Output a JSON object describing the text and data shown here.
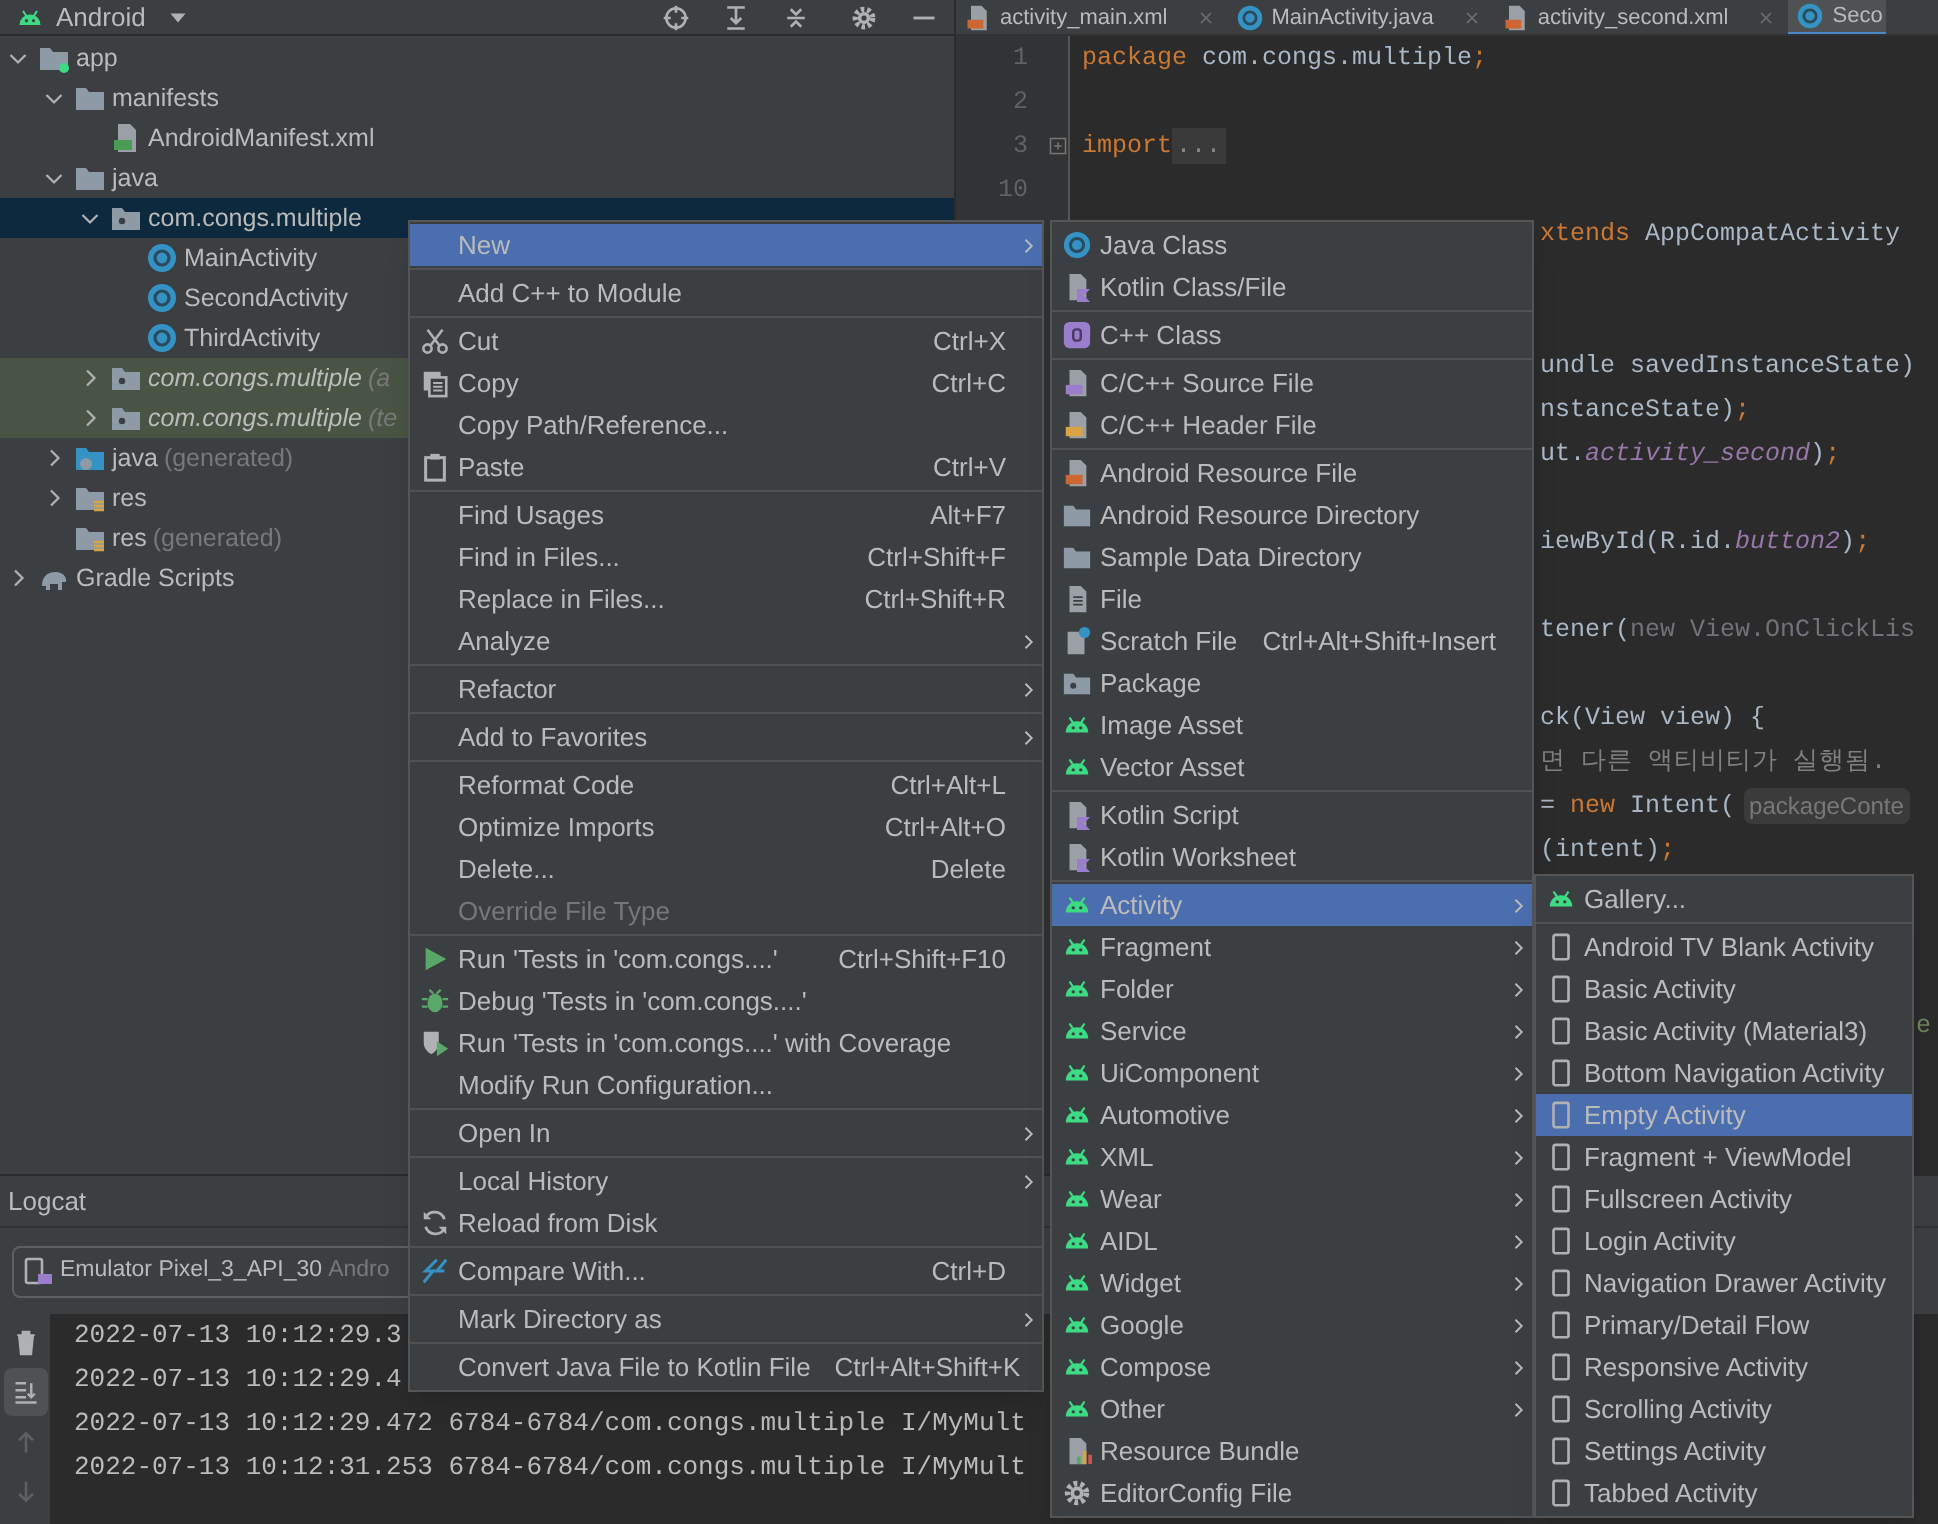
{
  "project_panel": {
    "title": "Android",
    "tree": [
      {
        "label": "app",
        "kind": "module",
        "expanded": true,
        "selected": false,
        "tinted": false,
        "children": [
          {
            "label": "manifests",
            "kind": "folder",
            "expanded": true,
            "selected": false,
            "tinted": false,
            "children": [
              {
                "label": "AndroidManifest.xml",
                "kind": "manifest",
                "selected": false,
                "tinted": false
              }
            ]
          },
          {
            "label": "java",
            "kind": "folder",
            "expanded": true,
            "selected": false,
            "tinted": false,
            "children": [
              {
                "label": "com.congs.multiple",
                "kind": "package",
                "expanded": true,
                "selected": true,
                "tinted": false,
                "children": [
                  {
                    "label": "MainActivity",
                    "kind": "class",
                    "selected": false,
                    "tinted": false
                  },
                  {
                    "label": "SecondActivity",
                    "kind": "class",
                    "selected": false,
                    "tinted": false
                  },
                  {
                    "label": "ThirdActivity",
                    "kind": "class",
                    "selected": false,
                    "tinted": false
                  }
                ]
              },
              {
                "label": "com.congs.multiple",
                "note": "(a",
                "kind": "package",
                "expanded": false,
                "selected": false,
                "tinted": true
              },
              {
                "label": "com.congs.multiple",
                "note": "(te",
                "kind": "package",
                "expanded": false,
                "selected": false,
                "tinted": true
              }
            ]
          },
          {
            "label": "java",
            "note": "(generated)",
            "kind": "generated-folder",
            "expanded": false,
            "selected": false,
            "tinted": false
          },
          {
            "label": "res",
            "kind": "res-folder",
            "expanded": false,
            "selected": false,
            "tinted": false
          },
          {
            "label": "res",
            "note": "(generated)",
            "kind": "res-folder",
            "selected": false,
            "tinted": false
          }
        ]
      },
      {
        "label": "Gradle Scripts",
        "kind": "gradle",
        "expanded": false,
        "selected": false,
        "tinted": false
      }
    ]
  },
  "editor": {
    "tabs": [
      {
        "label": "activity_main.xml",
        "kind": "xml",
        "selected": false,
        "closable": true
      },
      {
        "label": "MainActivity.java",
        "kind": "java",
        "selected": false,
        "closable": true
      },
      {
        "label": "activity_second.xml",
        "kind": "xml",
        "selected": false,
        "closable": true
      },
      {
        "label": "Seco",
        "kind": "java",
        "selected": true,
        "closable": false
      }
    ],
    "lines": [
      {
        "number": "1",
        "tokens": [
          {
            "kind": "keyword",
            "text": "package "
          },
          {
            "kind": "plain",
            "text": "com.congs.multiple"
          },
          {
            "kind": "keyword",
            "text": ";"
          }
        ]
      },
      {
        "number": "2"
      },
      {
        "number": "3",
        "tokens": [
          {
            "kind": "keyword",
            "text": "import "
          },
          {
            "kind": "fold",
            "text": "..."
          }
        ]
      },
      {
        "number": "10"
      },
      {
        "tokens": [
          {
            "kind": "keyword",
            "text": "xtends "
          },
          {
            "kind": "plain",
            "text": "AppCompatActivity"
          }
        ]
      },
      {
        "tokens": [
          {
            "kind": "plain",
            "text": "undle savedInstanceState)"
          }
        ]
      },
      {
        "tokens": [
          {
            "kind": "plain",
            "text": "nstanceState)"
          },
          {
            "kind": "keyword",
            "text": ";"
          }
        ]
      },
      {
        "tokens": [
          {
            "kind": "plain",
            "text": "ut."
          },
          {
            "kind": "field",
            "text": "activity_second"
          },
          {
            "kind": "plain",
            "text": ")"
          },
          {
            "kind": "keyword",
            "text": ";"
          }
        ]
      },
      {
        "tokens": [
          {
            "kind": "plain",
            "text": "iewById(R.id."
          },
          {
            "kind": "field",
            "text": "button2"
          },
          {
            "kind": "plain",
            "text": ")"
          },
          {
            "kind": "keyword",
            "text": ";"
          }
        ]
      },
      {
        "tokens": [
          {
            "kind": "plain",
            "text": "tener("
          },
          {
            "kind": "dim",
            "text": "new View.OnClickLis"
          }
        ]
      },
      {
        "tokens": [
          {
            "kind": "plain",
            "text": "ck(View view) {"
          }
        ]
      },
      {
        "tokens": [
          {
            "kind": "comment",
            "text": "면 다른 액티비티가 실행됨."
          }
        ]
      },
      {
        "tokens": [
          {
            "kind": "plain",
            "text": "= "
          },
          {
            "kind": "keyword",
            "text": "new "
          },
          {
            "kind": "plain",
            "text": "Intent("
          },
          {
            "kind": "hint",
            "text": "packageConte"
          }
        ]
      },
      {
        "tokens": [
          {
            "kind": "plain",
            "text": "(intent)"
          },
          {
            "kind": "keyword",
            "text": ";"
          }
        ]
      },
      {
        "tokens": [
          {
            "kind": "string",
            "text": "e"
          }
        ]
      }
    ]
  },
  "logcat": {
    "title": "Logcat",
    "device": "Emulator Pixel_3_API_30",
    "device_detail": "Andro",
    "tools": [
      {
        "kind": "trash",
        "on": false
      },
      {
        "kind": "scroll-end",
        "on": true
      },
      {
        "kind": "up",
        "on": false
      },
      {
        "kind": "down",
        "on": false
      }
    ],
    "lines": [
      "2022-07-13 10:12:29.3",
      "2022-07-13 10:12:29.4",
      "2022-07-13 10:12:29.472 6784-6784/com.congs.multiple I/MyMult",
      "2022-07-13 10:12:31.253 6784-6784/com.congs.multiple I/MyMult"
    ]
  },
  "context_menu": [
    [
      {
        "label": "New",
        "submenu": true,
        "selected": true,
        "disabled": false
      }
    ],
    [
      {
        "label": "Add C++ to Module",
        "submenu": false,
        "selected": false,
        "disabled": false
      }
    ],
    [
      {
        "label": "Cut",
        "kind": "cut",
        "shortcut": "Ctrl+X",
        "submenu": false,
        "selected": false,
        "disabled": false
      },
      {
        "label": "Copy",
        "kind": "copy",
        "shortcut": "Ctrl+C",
        "submenu": false,
        "selected": false,
        "disabled": false
      },
      {
        "label": "Copy Path/Reference...",
        "submenu": false,
        "selected": false,
        "disabled": false
      },
      {
        "label": "Paste",
        "kind": "paste",
        "shortcut": "Ctrl+V",
        "submenu": false,
        "selected": false,
        "disabled": false
      }
    ],
    [
      {
        "label": "Find Usages",
        "shortcut": "Alt+F7",
        "submenu": false,
        "selected": false,
        "disabled": false
      },
      {
        "label": "Find in Files...",
        "shortcut": "Ctrl+Shift+F",
        "submenu": false,
        "selected": false,
        "disabled": false
      },
      {
        "label": "Replace in Files...",
        "shortcut": "Ctrl+Shift+R",
        "submenu": false,
        "selected": false,
        "disabled": false
      },
      {
        "label": "Analyze",
        "submenu": true,
        "selected": false,
        "disabled": false
      }
    ],
    [
      {
        "label": "Refactor",
        "submenu": true,
        "selected": false,
        "disabled": false
      }
    ],
    [
      {
        "label": "Add to Favorites",
        "submenu": true,
        "selected": false,
        "disabled": false
      }
    ],
    [
      {
        "label": "Reformat Code",
        "shortcut": "Ctrl+Alt+L",
        "submenu": false,
        "selected": false,
        "disabled": false
      },
      {
        "label": "Optimize Imports",
        "shortcut": "Ctrl+Alt+O",
        "submenu": false,
        "selected": false,
        "disabled": false
      },
      {
        "label": "Delete...",
        "shortcut": "Delete",
        "submenu": false,
        "selected": false,
        "disabled": false
      },
      {
        "label": "Override File Type",
        "submenu": false,
        "selected": false,
        "disabled": true
      }
    ],
    [
      {
        "label": "Run 'Tests in 'com.congs....'",
        "kind": "run",
        "shortcut": "Ctrl+Shift+F10",
        "submenu": false,
        "selected": false,
        "disabled": false
      },
      {
        "label": "Debug 'Tests in 'com.congs....'",
        "kind": "debug",
        "submenu": false,
        "selected": false,
        "disabled": false
      },
      {
        "label": "Run 'Tests in 'com.congs....' with Coverage",
        "kind": "coverage",
        "submenu": false,
        "selected": false,
        "disabled": false
      },
      {
        "label": "Modify Run Configuration...",
        "submenu": false,
        "selected": false,
        "disabled": false
      }
    ],
    [
      {
        "label": "Open In",
        "submenu": true,
        "selected": false,
        "disabled": false
      }
    ],
    [
      {
        "label": "Local History",
        "submenu": true,
        "selected": false,
        "disabled": false
      },
      {
        "label": "Reload from Disk",
        "kind": "reload",
        "submenu": false,
        "selected": false,
        "disabled": false
      }
    ],
    [
      {
        "label": "Compare With...",
        "kind": "compare",
        "shortcut": "Ctrl+D",
        "submenu": false,
        "selected": false,
        "disabled": false
      }
    ],
    [
      {
        "label": "Mark Directory as",
        "submenu": true,
        "selected": false,
        "disabled": false
      }
    ],
    [
      {
        "label": "Convert Java File to Kotlin File",
        "shortcut": "Ctrl+Alt+Shift+K",
        "submenu": false,
        "selected": false,
        "disabled": false
      }
    ]
  ],
  "new_submenu": [
    [
      {
        "label": "Java Class",
        "kind": "java",
        "submenu": false,
        "selected": false
      },
      {
        "label": "Kotlin Class/File",
        "kind": "kotlin",
        "submenu": false,
        "selected": false
      }
    ],
    [
      {
        "label": "C++ Class",
        "kind": "cpp-class",
        "submenu": false,
        "selected": false
      }
    ],
    [
      {
        "label": "C/C++ Source File",
        "kind": "cpp-source",
        "submenu": false,
        "selected": false
      },
      {
        "label": "C/C++ Header File",
        "kind": "cpp-header",
        "submenu": false,
        "selected": false
      }
    ],
    [
      {
        "label": "Android Resource File",
        "kind": "res-file",
        "submenu": false,
        "selected": false
      },
      {
        "label": "Android Resource Directory",
        "kind": "folder",
        "submenu": false,
        "selected": false
      },
      {
        "label": "Sample Data Directory",
        "kind": "folder",
        "submenu": false,
        "selected": false
      },
      {
        "label": "File",
        "kind": "file",
        "submenu": false,
        "selected": false
      },
      {
        "label": "Scratch File",
        "kind": "scratch",
        "shortcut": "Ctrl+Alt+Shift+Insert",
        "submenu": false,
        "selected": false
      },
      {
        "label": "Package",
        "kind": "package",
        "submenu": false,
        "selected": false
      },
      {
        "label": "Image Asset",
        "kind": "android",
        "submenu": false,
        "selected": false
      },
      {
        "label": "Vector Asset",
        "kind": "android",
        "submenu": false,
        "selected": false
      }
    ],
    [
      {
        "label": "Kotlin Script",
        "kind": "kotlin",
        "submenu": false,
        "selected": false
      },
      {
        "label": "Kotlin Worksheet",
        "kind": "kotlin",
        "submenu": false,
        "selected": false
      }
    ],
    [
      {
        "label": "Activity",
        "kind": "android",
        "submenu": true,
        "selected": true
      },
      {
        "label": "Fragment",
        "kind": "android",
        "submenu": true,
        "selected": false
      },
      {
        "label": "Folder",
        "kind": "android",
        "submenu": true,
        "selected": false
      },
      {
        "label": "Service",
        "kind": "android",
        "submenu": true,
        "selected": false
      },
      {
        "label": "UiComponent",
        "kind": "android",
        "submenu": true,
        "selected": false
      },
      {
        "label": "Automotive",
        "kind": "android",
        "submenu": true,
        "selected": false
      },
      {
        "label": "XML",
        "kind": "android",
        "submenu": true,
        "selected": false
      },
      {
        "label": "Wear",
        "kind": "android",
        "submenu": true,
        "selected": false
      },
      {
        "label": "AIDL",
        "kind": "android",
        "submenu": true,
        "selected": false
      },
      {
        "label": "Widget",
        "kind": "android",
        "submenu": true,
        "selected": false
      },
      {
        "label": "Google",
        "kind": "android",
        "submenu": true,
        "selected": false
      },
      {
        "label": "Compose",
        "kind": "android",
        "submenu": true,
        "selected": false
      },
      {
        "label": "Other",
        "kind": "android",
        "submenu": true,
        "selected": false
      },
      {
        "label": "Resource Bundle",
        "kind": "bundle",
        "submenu": false,
        "selected": false
      },
      {
        "label": "EditorConfig File",
        "kind": "gear",
        "submenu": false,
        "selected": false
      }
    ]
  ],
  "activity_submenu": [
    [
      {
        "label": "Gallery...",
        "kind": "android",
        "selected": false
      }
    ],
    [
      {
        "label": "Android TV Blank Activity",
        "kind": "phone",
        "selected": false
      },
      {
        "label": "Basic Activity",
        "kind": "phone",
        "selected": false
      },
      {
        "label": "Basic Activity (Material3)",
        "kind": "phone",
        "selected": false
      },
      {
        "label": "Bottom Navigation Activity",
        "kind": "phone",
        "selected": false
      },
      {
        "label": "Empty Activity",
        "kind": "phone",
        "selected": true
      },
      {
        "label": "Fragment + ViewModel",
        "kind": "phone",
        "selected": false
      },
      {
        "label": "Fullscreen Activity",
        "kind": "phone",
        "selected": false
      },
      {
        "label": "Login Activity",
        "kind": "phone",
        "selected": false
      },
      {
        "label": "Navigation Drawer Activity",
        "kind": "phone",
        "selected": false
      },
      {
        "label": "Primary/Detail Flow",
        "kind": "phone",
        "selected": false
      },
      {
        "label": "Responsive Activity",
        "kind": "phone",
        "selected": false
      },
      {
        "label": "Scrolling Activity",
        "kind": "phone",
        "selected": false
      },
      {
        "label": "Settings Activity",
        "kind": "phone",
        "selected": false
      },
      {
        "label": "Tabbed Activity",
        "kind": "phone",
        "selected": false
      }
    ]
  ]
}
